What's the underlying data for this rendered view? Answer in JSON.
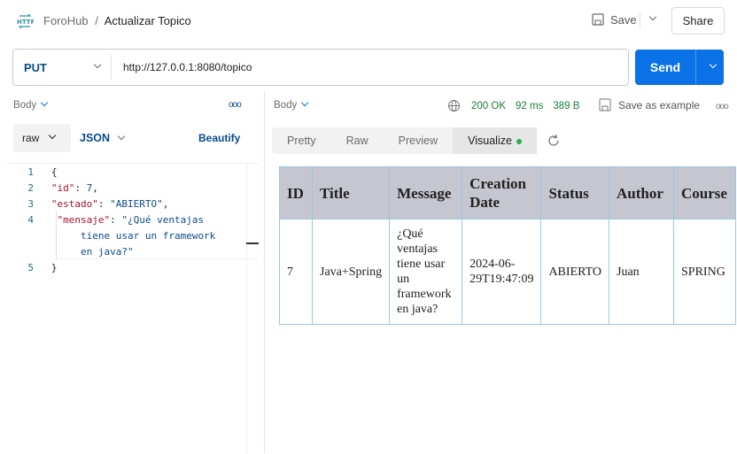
{
  "header": {
    "breadcrumb_parent": "ForoHub",
    "separator": "/",
    "title": "Actualizar Topico",
    "save_label": "Save",
    "share_label": "Share",
    "http_icon_text": "HTTP"
  },
  "request": {
    "method": "PUT",
    "url": "http://127.0.0.1:8080/topico",
    "send_label": "Send"
  },
  "left": {
    "body_label": "Body",
    "raw_label": "raw",
    "json_label": "JSON",
    "beautify_label": "Beautify",
    "code": [
      {
        "n": "1",
        "parts": [
          {
            "t": "{",
            "c": ""
          }
        ]
      },
      {
        "n": "2",
        "parts": [
          {
            "t": "\"id\"",
            "c": "key"
          },
          {
            "t": ": ",
            "c": ""
          },
          {
            "t": "7",
            "c": "num"
          },
          {
            "t": ",",
            "c": ""
          }
        ]
      },
      {
        "n": "3",
        "parts": [
          {
            "t": "\"estado\"",
            "c": "key"
          },
          {
            "t": ": ",
            "c": ""
          },
          {
            "t": "\"ABIERTO\"",
            "c": "str"
          },
          {
            "t": ",",
            "c": ""
          }
        ]
      },
      {
        "n": "4",
        "parts": [
          {
            "t": " \"mensaje\"",
            "c": "key"
          },
          {
            "t": ": ",
            "c": ""
          },
          {
            "t": "\"¿Qué ventajas",
            "c": "str"
          }
        ]
      },
      {
        "n": "",
        "parts": [
          {
            "t": "     tiene usar un framework",
            "c": "str"
          }
        ]
      },
      {
        "n": "",
        "parts": [
          {
            "t": "     en java?\"",
            "c": "str"
          }
        ]
      },
      {
        "n": "5",
        "parts": [
          {
            "t": "}",
            "c": ""
          }
        ]
      }
    ]
  },
  "response": {
    "body_label": "Body",
    "status": "200 OK",
    "time": "92 ms",
    "size": "389 B",
    "save_example_label": "Save as example",
    "tabs": [
      {
        "label": "Pretty"
      },
      {
        "label": "Raw"
      },
      {
        "label": "Preview"
      },
      {
        "label": "Visualize"
      }
    ],
    "active_tab": "Visualize",
    "status_color": "#1a7f37",
    "table": {
      "headers": [
        "ID",
        "Title",
        "Message",
        "Creation Date",
        "Status",
        "Author",
        "Course"
      ],
      "rows": [
        [
          "7",
          "Java+Spring",
          "¿Qué ventajas tiene usar un framework en java?",
          "2024-06-29T19:47:09",
          "ABIERTO",
          "Juan",
          "SPRING"
        ]
      ]
    }
  },
  "colors": {
    "accent": "#0265d2",
    "send": "#0a72e6"
  }
}
